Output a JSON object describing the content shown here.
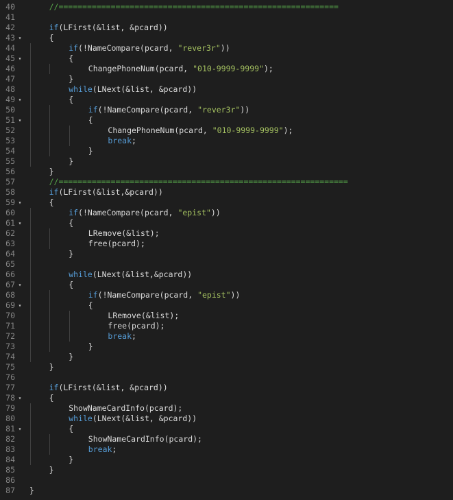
{
  "editor": {
    "lines": [
      {
        "n": "40",
        "fold": "",
        "indent": 1,
        "tokens": [
          {
            "t": "//===========================================================",
            "c": "cm"
          }
        ]
      },
      {
        "n": "41",
        "fold": "",
        "indent": 0,
        "tokens": []
      },
      {
        "n": "42",
        "fold": "",
        "indent": 1,
        "tokens": [
          {
            "t": "if",
            "c": "kw"
          },
          {
            "t": "(LFirst(&list, &pcard))",
            "c": "fn"
          }
        ]
      },
      {
        "n": "43",
        "fold": "▾",
        "indent": 1,
        "tokens": [
          {
            "t": "{",
            "c": "fn"
          }
        ]
      },
      {
        "n": "44",
        "fold": "",
        "indent": 2,
        "tokens": [
          {
            "t": "if",
            "c": "kw"
          },
          {
            "t": "(!NameCompare(pcard, ",
            "c": "fn"
          },
          {
            "t": "\"rever3r\"",
            "c": "s-green"
          },
          {
            "t": "))",
            "c": "fn"
          }
        ]
      },
      {
        "n": "45",
        "fold": "▾",
        "indent": 2,
        "tokens": [
          {
            "t": "{",
            "c": "fn"
          }
        ]
      },
      {
        "n": "46",
        "fold": "",
        "indent": 3,
        "tokens": [
          {
            "t": "ChangePhoneNum(pcard, ",
            "c": "fn"
          },
          {
            "t": "\"010-9999-9999\"",
            "c": "s-green"
          },
          {
            "t": ");",
            "c": "fn"
          }
        ]
      },
      {
        "n": "47",
        "fold": "",
        "indent": 2,
        "tokens": [
          {
            "t": "}",
            "c": "fn"
          }
        ]
      },
      {
        "n": "48",
        "fold": "",
        "indent": 2,
        "tokens": [
          {
            "t": "while",
            "c": "kw"
          },
          {
            "t": "(LNext(&list, &pcard))",
            "c": "fn"
          }
        ]
      },
      {
        "n": "49",
        "fold": "▾",
        "indent": 2,
        "tokens": [
          {
            "t": "{",
            "c": "fn"
          }
        ]
      },
      {
        "n": "50",
        "fold": "",
        "indent": 3,
        "tokens": [
          {
            "t": "if",
            "c": "kw"
          },
          {
            "t": "(!NameCompare(pcard, ",
            "c": "fn"
          },
          {
            "t": "\"rever3r\"",
            "c": "s-green"
          },
          {
            "t": "))",
            "c": "fn"
          }
        ]
      },
      {
        "n": "51",
        "fold": "▾",
        "indent": 3,
        "tokens": [
          {
            "t": "{",
            "c": "fn"
          }
        ]
      },
      {
        "n": "52",
        "fold": "",
        "indent": 4,
        "tokens": [
          {
            "t": "ChangePhoneNum(pcard, ",
            "c": "fn"
          },
          {
            "t": "\"010-9999-9999\"",
            "c": "s-green"
          },
          {
            "t": ");",
            "c": "fn"
          }
        ]
      },
      {
        "n": "53",
        "fold": "",
        "indent": 4,
        "tokens": [
          {
            "t": "break",
            "c": "kw"
          },
          {
            "t": ";",
            "c": "fn"
          }
        ]
      },
      {
        "n": "54",
        "fold": "",
        "indent": 3,
        "tokens": [
          {
            "t": "}",
            "c": "fn"
          }
        ]
      },
      {
        "n": "55",
        "fold": "",
        "indent": 2,
        "tokens": [
          {
            "t": "}",
            "c": "fn"
          }
        ]
      },
      {
        "n": "56",
        "fold": "",
        "indent": 1,
        "tokens": [
          {
            "t": "}",
            "c": "fn"
          }
        ]
      },
      {
        "n": "57",
        "fold": "",
        "indent": 1,
        "tokens": [
          {
            "t": "//=============================================================",
            "c": "cm"
          }
        ]
      },
      {
        "n": "58",
        "fold": "",
        "indent": 1,
        "tokens": [
          {
            "t": "if",
            "c": "kw"
          },
          {
            "t": "(LFirst(&list,&pcard))",
            "c": "fn"
          }
        ]
      },
      {
        "n": "59",
        "fold": "▾",
        "indent": 1,
        "tokens": [
          {
            "t": "{",
            "c": "fn"
          }
        ]
      },
      {
        "n": "60",
        "fold": "",
        "indent": 2,
        "tokens": [
          {
            "t": "if",
            "c": "kw"
          },
          {
            "t": "(!NameCompare(pcard, ",
            "c": "fn"
          },
          {
            "t": "\"epist\"",
            "c": "s-green"
          },
          {
            "t": "))",
            "c": "fn"
          }
        ]
      },
      {
        "n": "61",
        "fold": "▾",
        "indent": 2,
        "tokens": [
          {
            "t": "{",
            "c": "fn"
          }
        ]
      },
      {
        "n": "62",
        "fold": "",
        "indent": 3,
        "tokens": [
          {
            "t": "LRemove(&list);",
            "c": "fn"
          }
        ]
      },
      {
        "n": "63",
        "fold": "",
        "indent": 3,
        "tokens": [
          {
            "t": "free(pcard);",
            "c": "fn"
          }
        ]
      },
      {
        "n": "64",
        "fold": "",
        "indent": 2,
        "tokens": [
          {
            "t": "}",
            "c": "fn"
          }
        ]
      },
      {
        "n": "65",
        "fold": "",
        "indent": 0,
        "tokens": []
      },
      {
        "n": "66",
        "fold": "",
        "indent": 2,
        "tokens": [
          {
            "t": "while",
            "c": "kw"
          },
          {
            "t": "(LNext(&list,&pcard))",
            "c": "fn"
          }
        ]
      },
      {
        "n": "67",
        "fold": "▾",
        "indent": 2,
        "tokens": [
          {
            "t": "{",
            "c": "fn"
          }
        ]
      },
      {
        "n": "68",
        "fold": "",
        "indent": 3,
        "tokens": [
          {
            "t": "if",
            "c": "kw"
          },
          {
            "t": "(!NameCompare(pcard, ",
            "c": "fn"
          },
          {
            "t": "\"epist\"",
            "c": "s-green"
          },
          {
            "t": "))",
            "c": "fn"
          }
        ]
      },
      {
        "n": "69",
        "fold": "▾",
        "indent": 3,
        "tokens": [
          {
            "t": "{",
            "c": "fn"
          }
        ]
      },
      {
        "n": "70",
        "fold": "",
        "indent": 4,
        "tokens": [
          {
            "t": "LRemove(&list);",
            "c": "fn"
          }
        ]
      },
      {
        "n": "71",
        "fold": "",
        "indent": 4,
        "tokens": [
          {
            "t": "free(pcard);",
            "c": "fn"
          }
        ]
      },
      {
        "n": "72",
        "fold": "",
        "indent": 4,
        "tokens": [
          {
            "t": "break",
            "c": "kw"
          },
          {
            "t": ";",
            "c": "fn"
          }
        ]
      },
      {
        "n": "73",
        "fold": "",
        "indent": 3,
        "tokens": [
          {
            "t": "}",
            "c": "fn"
          }
        ]
      },
      {
        "n": "74",
        "fold": "",
        "indent": 2,
        "tokens": [
          {
            "t": "}",
            "c": "fn"
          }
        ]
      },
      {
        "n": "75",
        "fold": "",
        "indent": 1,
        "tokens": [
          {
            "t": "}",
            "c": "fn"
          }
        ]
      },
      {
        "n": "76",
        "fold": "",
        "indent": 0,
        "tokens": []
      },
      {
        "n": "77",
        "fold": "",
        "indent": 1,
        "tokens": [
          {
            "t": "if",
            "c": "kw"
          },
          {
            "t": "(LFirst(&list, &pcard))",
            "c": "fn"
          }
        ]
      },
      {
        "n": "78",
        "fold": "▾",
        "indent": 1,
        "tokens": [
          {
            "t": "{",
            "c": "fn"
          }
        ]
      },
      {
        "n": "79",
        "fold": "",
        "indent": 2,
        "tokens": [
          {
            "t": "ShowNameCardInfo(pcard);",
            "c": "fn"
          }
        ]
      },
      {
        "n": "80",
        "fold": "",
        "indent": 2,
        "tokens": [
          {
            "t": "while",
            "c": "kw"
          },
          {
            "t": "(LNext(&list, &pcard))",
            "c": "fn"
          }
        ]
      },
      {
        "n": "81",
        "fold": "▾",
        "indent": 2,
        "tokens": [
          {
            "t": "{",
            "c": "fn"
          }
        ]
      },
      {
        "n": "82",
        "fold": "",
        "indent": 3,
        "tokens": [
          {
            "t": "ShowNameCardInfo(pcard);",
            "c": "fn"
          }
        ]
      },
      {
        "n": "83",
        "fold": "",
        "indent": 3,
        "tokens": [
          {
            "t": "break",
            "c": "kw"
          },
          {
            "t": ";",
            "c": "fn"
          }
        ]
      },
      {
        "n": "84",
        "fold": "",
        "indent": 2,
        "tokens": [
          {
            "t": "}",
            "c": "fn"
          }
        ]
      },
      {
        "n": "85",
        "fold": "",
        "indent": 1,
        "tokens": [
          {
            "t": "}",
            "c": "fn"
          }
        ]
      },
      {
        "n": "86",
        "fold": "",
        "indent": 0,
        "tokens": []
      },
      {
        "n": "87",
        "fold": "",
        "indent": 0,
        "tokens": [
          {
            "t": "}",
            "c": "fn"
          }
        ]
      }
    ]
  },
  "colors": {
    "background": "#1e1e1e",
    "line_number": "#858585",
    "keyword": "#569cd6",
    "string": "#a5c261",
    "comment": "#57a64a",
    "text": "#dcdcdc"
  }
}
